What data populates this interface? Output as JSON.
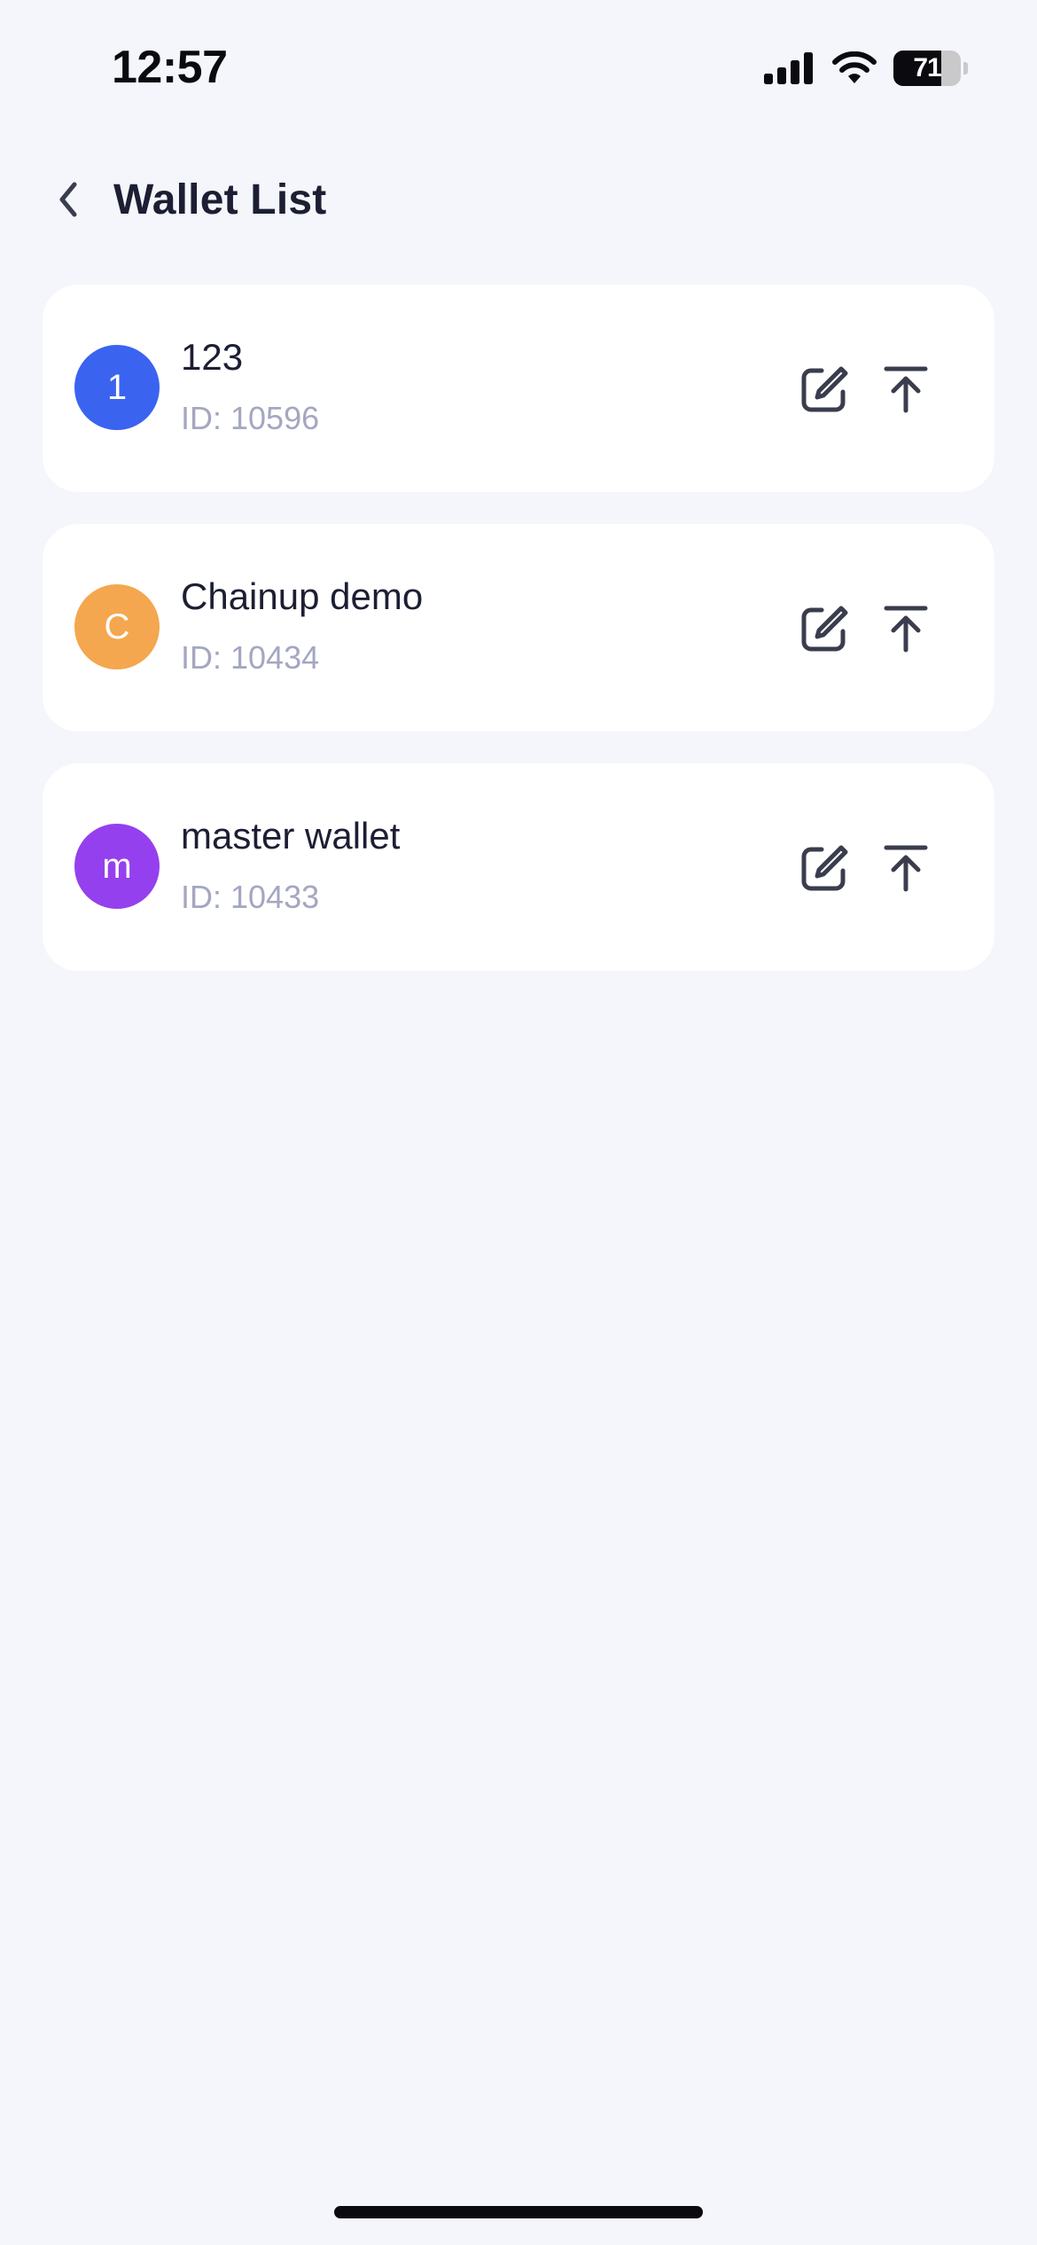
{
  "status_bar": {
    "time": "12:57",
    "battery_level": "71",
    "battery_fraction": 0.71
  },
  "header": {
    "title": "Wallet List",
    "back_icon": "chevron-left-icon"
  },
  "wallets": [
    {
      "initial": "1",
      "name": "123",
      "id_label": "ID:",
      "id_value": "10596",
      "avatar_color": "#3a63f0"
    },
    {
      "initial": "C",
      "name": "Chainup demo",
      "id_label": "ID:",
      "id_value": "10434",
      "avatar_color": "#f4a74e"
    },
    {
      "initial": "m",
      "name": "master wallet",
      "id_label": "ID:",
      "id_value": "10433",
      "avatar_color": "#9540ee"
    }
  ],
  "icons": {
    "edit": "edit-icon",
    "pin_top": "pin-to-top-icon"
  },
  "colors": {
    "background": "#f4f6fc",
    "card": "#ffffff",
    "text_primary": "#1c1f33",
    "text_secondary": "#a3a7c0",
    "icon": "#3a3d4d"
  }
}
